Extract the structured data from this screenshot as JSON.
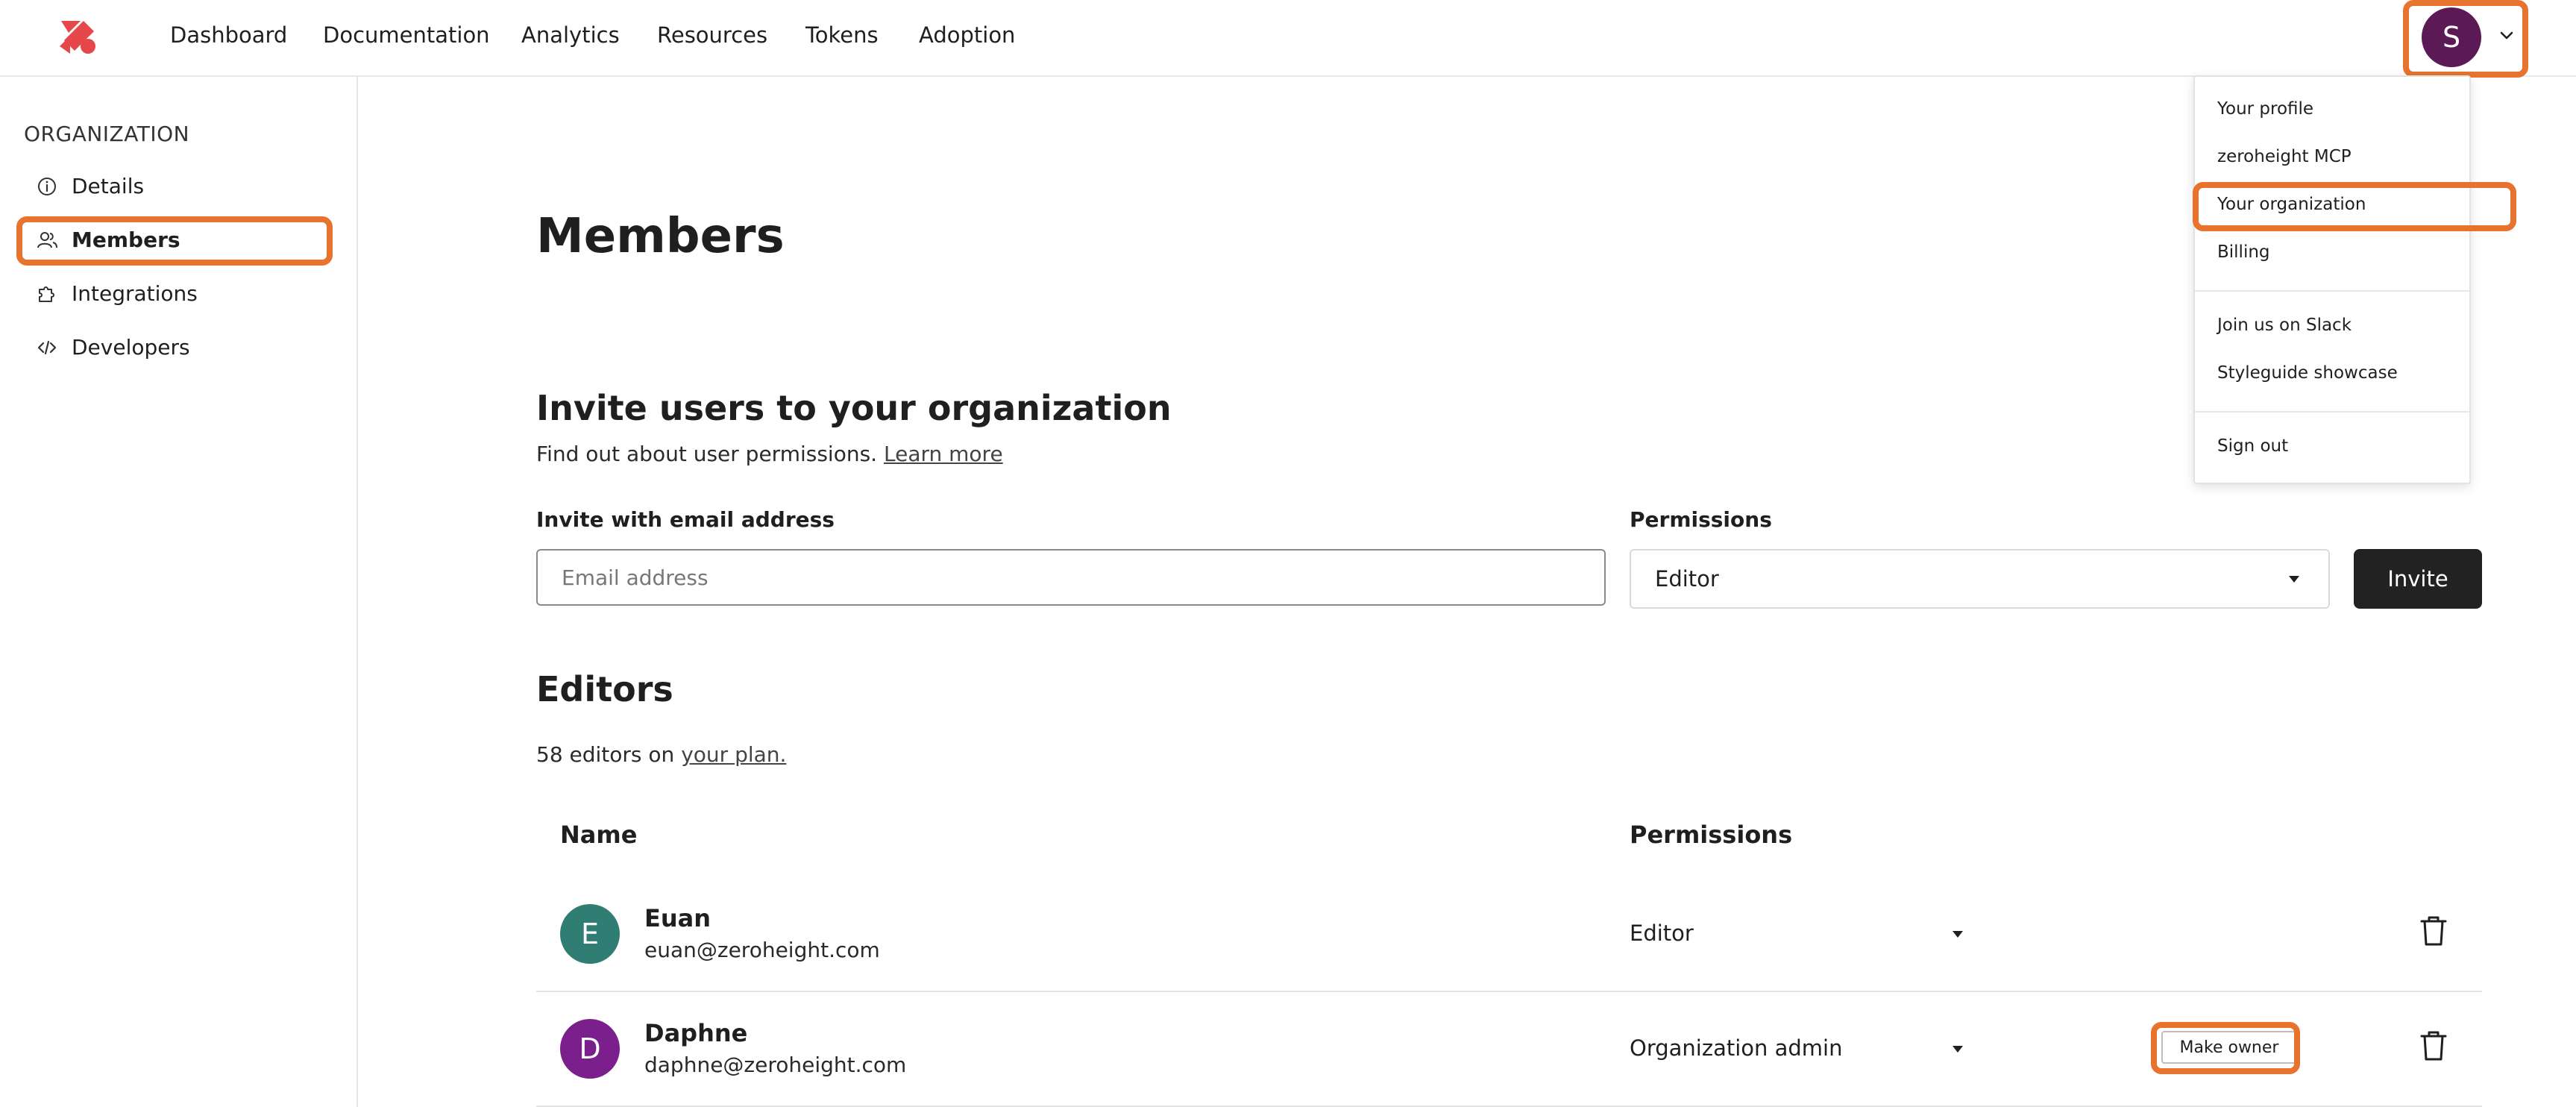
{
  "colors": {
    "brand": "#e5474b",
    "avatar_user": "#5b1a56",
    "avatar_euan": "#2f7d73",
    "avatar_daphne": "#7a1f8b",
    "highlight": "#e8732e",
    "button_dark": "#222222"
  },
  "nav": {
    "items": [
      "Dashboard",
      "Documentation",
      "Analytics",
      "Resources",
      "Tokens",
      "Adoption"
    ],
    "avatar_initial": "S"
  },
  "menu": {
    "items": [
      "Your profile",
      "zeroheight MCP",
      "Your organization",
      "Billing",
      "Join us on Slack",
      "Styleguide showcase",
      "Sign out"
    ]
  },
  "sidebar": {
    "heading": "ORGANIZATION",
    "items": [
      {
        "label": "Details",
        "icon": "info-icon"
      },
      {
        "label": "Members",
        "icon": "users-icon"
      },
      {
        "label": "Integrations",
        "icon": "puzzle-icon"
      },
      {
        "label": "Developers",
        "icon": "code-icon"
      }
    ]
  },
  "main": {
    "title": "Members",
    "invite": {
      "heading": "Invite users to your organization",
      "subtitle": "Find out about user permissions.",
      "learn_more": "Learn more",
      "email_label": "Invite with email address",
      "email_placeholder": "Email address",
      "email_value": "",
      "permissions_label": "Permissions",
      "permissions_value": "Editor",
      "invite_button": "Invite"
    },
    "editors": {
      "heading": "Editors",
      "count_text": "58 editors on",
      "plan_link": "your plan.",
      "columns": [
        "Name",
        "Permissions"
      ],
      "rows": [
        {
          "initial": "E",
          "name": "Euan",
          "email": "euan@zeroheight.com",
          "permission": "Editor"
        },
        {
          "initial": "D",
          "name": "Daphne",
          "email": "daphne@zeroheight.com",
          "permission": "Organization admin",
          "action": "Make owner"
        }
      ]
    }
  }
}
